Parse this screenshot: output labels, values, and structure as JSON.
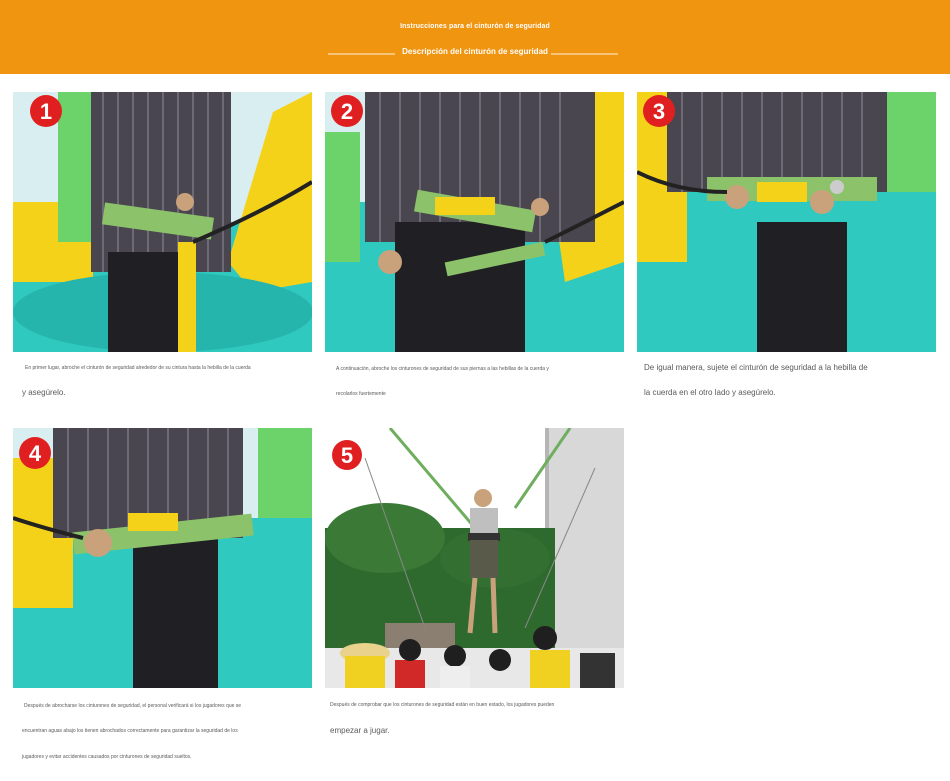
{
  "header": {
    "subtitle": "Instrucciones para el cinturón de seguridad",
    "title": "Descripción del cinturón de seguridad"
  },
  "steps": [
    {
      "number": "1",
      "lines": [
        "En primer lugar, abroche el cinturón de seguridad alrededor de su cintura hasta la hebilla de la cuerda",
        "y asegúrelo."
      ]
    },
    {
      "number": "2",
      "lines": [
        "A continuación, abroche los cinturones de seguridad de sus piernas a las hebillas de la cuerda y",
        "recolarlos fuertemente"
      ]
    },
    {
      "number": "3",
      "lines": [
        "De igual manera, sujete el cinturón de seguridad a la hebilla de",
        "la cuerda en el otro lado y asegúrelo."
      ]
    },
    {
      "number": "4",
      "lines": [
        "Después de abrocharse los cinturones de seguridad, el personal verificará si los jugadores que se",
        "encuentran aguas abajo los tienen abrochados correctamente para garantizar la seguridad de los",
        "jugadores y evitar accidentes causados por cinturones de seguridad sueltos."
      ]
    },
    {
      "number": "5",
      "lines": [
        "Después de comprobar que los cinturones de seguridad están en buen estado, los jugadores pueden",
        "empezar a jugar."
      ]
    }
  ],
  "colors": {
    "header": "#f0950f",
    "badge": "#e02020",
    "inflatable_teal": "#2fc9c0",
    "inflatable_yellow": "#f5d21a",
    "inflatable_green": "#6cd36a",
    "belt": "#8cc26a"
  }
}
